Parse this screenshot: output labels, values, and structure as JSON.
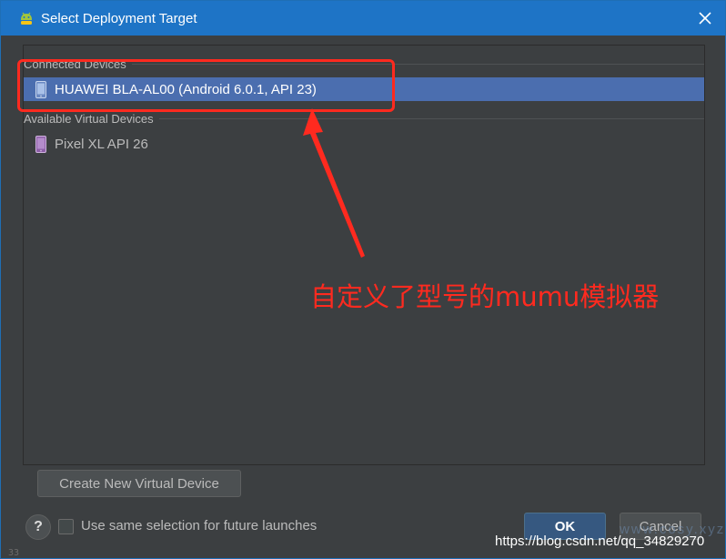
{
  "window": {
    "title": "Select Deployment Target",
    "title_icon": "android-icon",
    "close_icon": "close-icon"
  },
  "sections": [
    {
      "header": "Connected Devices",
      "devices": [
        {
          "label": "HUAWEI BLA-AL00 (Android 6.0.1, API 23)",
          "icon": "phone-icon",
          "selected": true
        }
      ]
    },
    {
      "header": "Available Virtual Devices",
      "devices": [
        {
          "label": "Pixel XL API 26",
          "icon": "virtual-phone-icon",
          "selected": false
        }
      ]
    }
  ],
  "buttons": {
    "create_virtual_device": "Create New Virtual Device",
    "ok": "OK",
    "cancel": "Cancel",
    "help": "?"
  },
  "footer": {
    "checkbox_label": "Use same selection for future launches",
    "checkbox_checked": false
  },
  "annotation": {
    "text": "自定义了型号的mumu模拟器",
    "color": "#ff2a1f"
  },
  "watermark": {
    "text": "https://blog.csdn.net/qq_34829270",
    "faint_text": "www.cosy.xyz"
  },
  "editor_gutter": {
    "line_number": "33"
  },
  "colors": {
    "titlebar": "#1e74c6",
    "selection": "#4b6eaf",
    "dialog_bg": "#3c3f41",
    "primary_button": "#365880"
  }
}
